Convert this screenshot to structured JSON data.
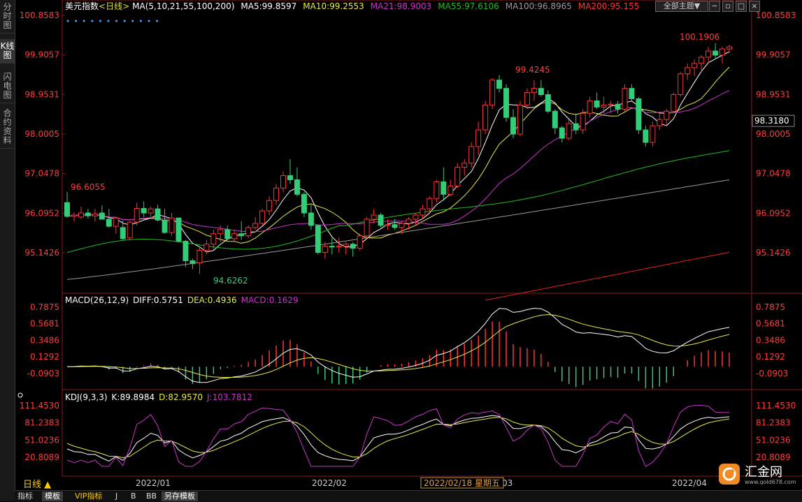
{
  "left_tabs": [
    "分时图",
    "K线图",
    "闪电图",
    "合约资料"
  ],
  "main_header": {
    "title": "美元指数",
    "period": "<日线>",
    "ma_prefix": "MA(5,10,21,55,100,200)",
    "ma5": "MA5:99.8597",
    "ma10": "MA10:99.2553",
    "ma21": "MA21:98.9003",
    "ma55": "MA55:97.6106",
    "ma100": "MA100:96.8965",
    "ma200": "MA200:95.155"
  },
  "top_buttons": {
    "theme": "全部主题",
    "theme_arrow": "▼"
  },
  "price_labels": [
    "100.8583",
    "99.9057",
    "98.9531",
    "98.0005",
    "97.0478",
    "96.0952",
    "95.1426"
  ],
  "price_current": "98.3180",
  "annotations": {
    "high_left": "96.6055",
    "low": "94.6262",
    "high_mid": "99.4245",
    "high_right": "100.1906"
  },
  "macd_header": {
    "label": "MACD(26,12,9)",
    "diff": "DIFF:0.5751",
    "dea": "DEA:0.4936",
    "macd": "MACD:0.1629"
  },
  "macd_labels": [
    "0.7875",
    "0.5681",
    "0.3486",
    "0.1292",
    "-0.0903"
  ],
  "kdj_header": {
    "label": "KDJ(9,3,3)",
    "k": "K:89.8984",
    "d": "D:82.9570",
    "j": "J:103.7812"
  },
  "kdj_labels": [
    "111.4530",
    "81.2383",
    "51.0236",
    "20.8089"
  ],
  "x_axis": {
    "ticks": [
      "2022/01",
      "2022/02",
      "03",
      "2022/04"
    ],
    "cursor": "2022/02/18 星期五"
  },
  "period_label": "日线 ▲",
  "bottom_tabs": [
    "指标",
    "模板",
    "VIP指标",
    "J",
    "B",
    "BB",
    "另存模板"
  ],
  "logo": {
    "text": "汇金网",
    "url": "www.gold678.com"
  },
  "colors": {
    "up": "#ff3333",
    "down": "#33cc77",
    "ma5": "#ffffff",
    "ma10": "#e8e84a",
    "ma21": "#cc33cc",
    "ma55": "#22bb22",
    "ma100": "#999999",
    "ma200": "#e02020",
    "axis_text": "#ff3b3b"
  },
  "chart_data": {
    "type": "candlestick",
    "price_axis_ticks": [
      100.8583,
      99.9057,
      98.9531,
      98.0005,
      97.0478,
      96.0952,
      95.1426
    ],
    "ohlc": [
      [
        96.35,
        96.61,
        95.98,
        96.02
      ],
      [
        96.02,
        96.12,
        95.9,
        96.05
      ],
      [
        96.0,
        96.25,
        95.95,
        96.1
      ],
      [
        96.1,
        96.2,
        95.96,
        96.03
      ],
      [
        96.03,
        96.2,
        95.9,
        96.08
      ],
      [
        96.1,
        96.28,
        95.95,
        95.95
      ],
      [
        95.95,
        96.2,
        95.75,
        95.78
      ],
      [
        95.78,
        96.0,
        95.6,
        95.98
      ],
      [
        95.75,
        95.92,
        95.45,
        95.48
      ],
      [
        95.5,
        95.9,
        95.45,
        95.88
      ],
      [
        95.88,
        96.35,
        95.8,
        96.21
      ],
      [
        96.21,
        96.38,
        96.0,
        96.1
      ],
      [
        96.1,
        96.26,
        95.95,
        96.2
      ],
      [
        96.2,
        96.3,
        95.9,
        95.93
      ],
      [
        95.93,
        96.2,
        95.6,
        95.63
      ],
      [
        95.63,
        96.1,
        95.55,
        95.98
      ],
      [
        95.98,
        95.98,
        95.4,
        95.42
      ],
      [
        95.42,
        95.45,
        94.8,
        94.95
      ],
      [
        94.95,
        95.0,
        94.75,
        94.88
      ],
      [
        94.9,
        95.3,
        94.63,
        95.2
      ],
      [
        95.2,
        95.45,
        95.1,
        95.35
      ],
      [
        95.35,
        95.7,
        95.2,
        95.6
      ],
      [
        95.6,
        95.8,
        95.4,
        95.7
      ],
      [
        95.7,
        95.8,
        95.45,
        95.48
      ],
      [
        95.48,
        95.7,
        95.42,
        95.6
      ],
      [
        95.6,
        95.9,
        95.45,
        95.55
      ],
      [
        95.55,
        95.8,
        95.5,
        95.75
      ],
      [
        95.75,
        96.0,
        95.7,
        95.85
      ],
      [
        95.85,
        96.2,
        95.8,
        96.15
      ],
      [
        96.15,
        96.5,
        96.05,
        96.4
      ],
      [
        96.4,
        96.8,
        96.3,
        96.7
      ],
      [
        96.7,
        97.1,
        96.6,
        97.0
      ],
      [
        97.0,
        97.4,
        96.8,
        96.9
      ],
      [
        96.9,
        97.2,
        96.5,
        96.55
      ],
      [
        96.55,
        96.6,
        96.0,
        96.1
      ],
      [
        96.1,
        96.3,
        95.7,
        95.8
      ],
      [
        95.8,
        95.82,
        95.1,
        95.15
      ],
      [
        95.15,
        95.4,
        95.0,
        95.3
      ],
      [
        95.3,
        95.5,
        95.1,
        95.28
      ],
      [
        95.28,
        95.5,
        95.15,
        95.3
      ],
      [
        95.3,
        95.4,
        95.1,
        95.35
      ],
      [
        95.35,
        95.4,
        95.05,
        95.25
      ],
      [
        95.25,
        95.6,
        95.2,
        95.55
      ],
      [
        95.55,
        96.0,
        95.5,
        95.95
      ],
      [
        95.95,
        96.2,
        95.85,
        96.05
      ],
      [
        96.05,
        96.1,
        95.75,
        95.8
      ],
      [
        95.8,
        95.95,
        95.7,
        95.82
      ],
      [
        95.82,
        95.95,
        95.7,
        95.75
      ],
      [
        95.75,
        95.9,
        95.6,
        95.85
      ],
      [
        95.85,
        96.0,
        95.7,
        95.95
      ],
      [
        95.95,
        96.1,
        95.8,
        96.05
      ],
      [
        96.05,
        96.3,
        95.95,
        96.2
      ],
      [
        96.2,
        96.5,
        96.1,
        96.45
      ],
      [
        96.45,
        96.9,
        96.35,
        96.85
      ],
      [
        96.85,
        97.2,
        96.4,
        96.55
      ],
      [
        96.55,
        96.9,
        96.5,
        96.75
      ],
      [
        96.75,
        97.3,
        96.7,
        97.2
      ],
      [
        97.2,
        97.4,
        97.0,
        97.3
      ],
      [
        97.3,
        97.8,
        97.2,
        97.7
      ],
      [
        97.7,
        98.3,
        97.5,
        98.1
      ],
      [
        98.1,
        98.8,
        98.0,
        98.7
      ],
      [
        98.7,
        99.35,
        98.6,
        99.3
      ],
      [
        99.3,
        99.42,
        99.0,
        99.1
      ],
      [
        99.1,
        99.2,
        98.3,
        98.4
      ],
      [
        98.4,
        98.6,
        97.9,
        98.0
      ],
      [
        98.0,
        98.8,
        97.95,
        98.7
      ],
      [
        98.7,
        99.1,
        98.6,
        99.0
      ],
      [
        99.0,
        99.3,
        98.8,
        99.1
      ],
      [
        99.1,
        99.3,
        98.9,
        98.95
      ],
      [
        98.95,
        99.05,
        98.5,
        98.55
      ],
      [
        98.55,
        98.6,
        98.0,
        98.15
      ],
      [
        98.15,
        98.2,
        97.8,
        97.9
      ],
      [
        97.9,
        98.35,
        97.85,
        98.25
      ],
      [
        98.25,
        98.5,
        98.0,
        98.1
      ],
      [
        98.1,
        98.6,
        98.0,
        98.5
      ],
      [
        98.5,
        98.9,
        98.4,
        98.8
      ],
      [
        98.8,
        99.0,
        98.6,
        98.65
      ],
      [
        98.65,
        98.9,
        98.5,
        98.7
      ],
      [
        98.7,
        98.8,
        98.5,
        98.72
      ],
      [
        98.72,
        98.8,
        98.5,
        98.6
      ],
      [
        98.6,
        99.2,
        98.55,
        99.1
      ],
      [
        99.1,
        99.2,
        98.8,
        98.85
      ],
      [
        98.85,
        98.9,
        98.0,
        98.1
      ],
      [
        98.1,
        98.2,
        97.7,
        97.8
      ],
      [
        97.8,
        98.3,
        97.7,
        98.2
      ],
      [
        98.2,
        98.5,
        98.1,
        98.35
      ],
      [
        98.35,
        98.6,
        98.2,
        98.55
      ],
      [
        98.55,
        99.0,
        98.5,
        98.95
      ],
      [
        98.95,
        99.5,
        98.9,
        99.45
      ],
      [
        99.45,
        99.7,
        99.3,
        99.6
      ],
      [
        99.6,
        99.8,
        99.4,
        99.7
      ],
      [
        99.7,
        99.9,
        99.5,
        99.85
      ],
      [
        99.85,
        100.1,
        99.7,
        100.0
      ],
      [
        100.0,
        100.19,
        99.8,
        99.9
      ],
      [
        99.9,
        100.1,
        99.7,
        100.05
      ],
      [
        100.05,
        100.15,
        99.95,
        100.1
      ]
    ],
    "ma_lines": [
      {
        "name": "MA5",
        "last": 99.8597
      },
      {
        "name": "MA10",
        "last": 99.2553
      },
      {
        "name": "MA21",
        "last": 98.9003
      },
      {
        "name": "MA55",
        "last": 97.6106
      },
      {
        "name": "MA100",
        "last": 96.8965
      },
      {
        "name": "MA200",
        "last": 95.155
      }
    ],
    "macd": {
      "diff": 0.5751,
      "dea": 0.4936,
      "macd": 0.1629,
      "axis_ticks": [
        0.7875,
        0.5681,
        0.3486,
        0.1292,
        -0.0903
      ]
    },
    "kdj": {
      "k": 89.8984,
      "d": 82.957,
      "j": 103.7812,
      "axis_ticks": [
        111.453,
        81.2383,
        51.0236,
        20.8089
      ]
    }
  }
}
